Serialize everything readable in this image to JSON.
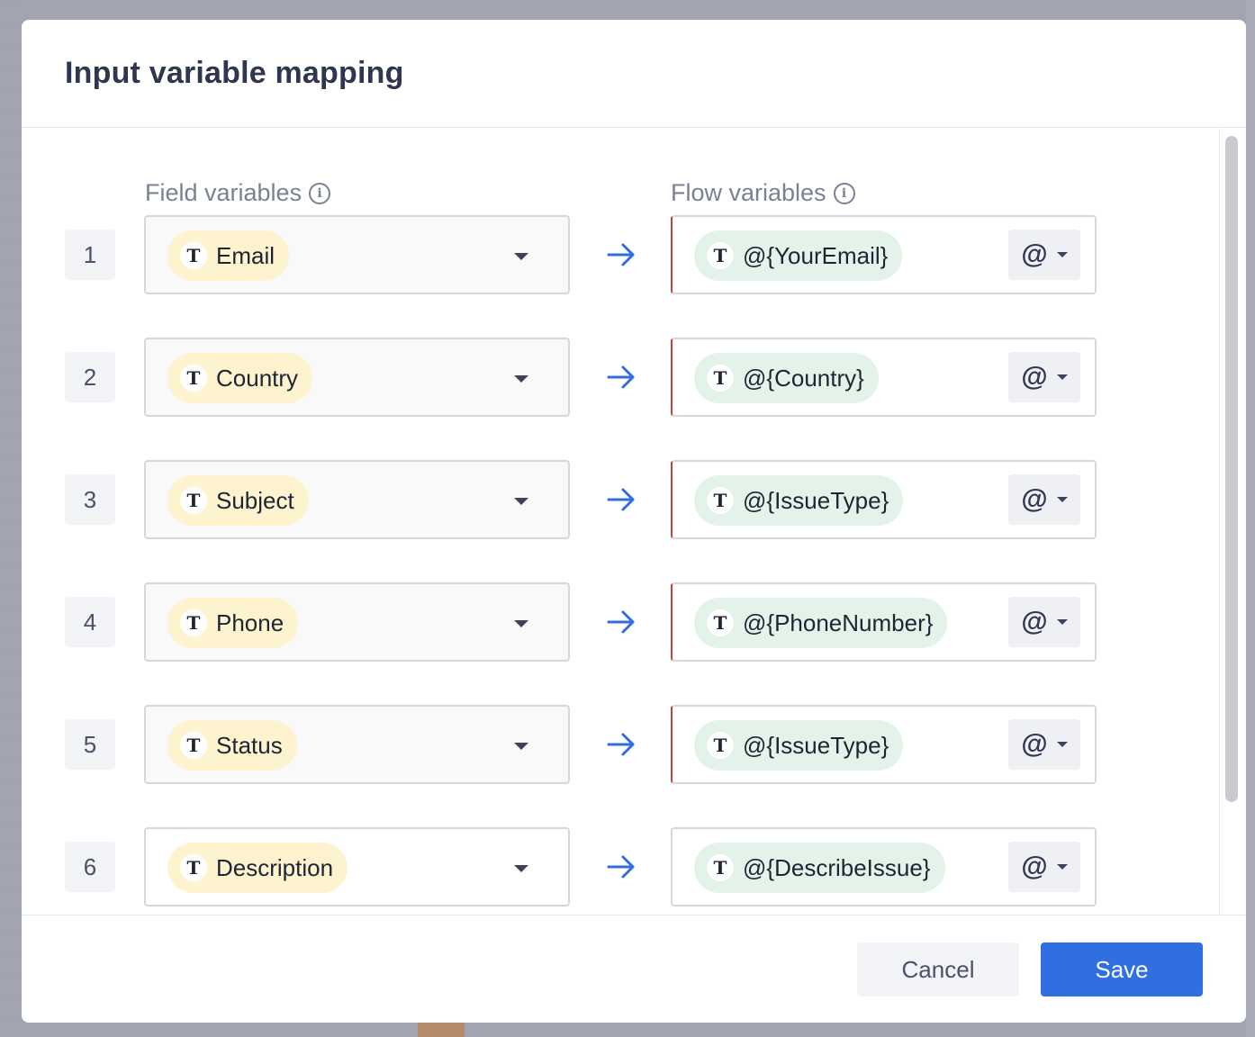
{
  "dialog": {
    "title": "Input variable mapping",
    "field_header": "Field variables",
    "flow_header": "Flow variables",
    "info_icon_glyph": "i"
  },
  "rows": [
    {
      "num": "1",
      "field": "Email",
      "flow": "@{YourEmail}",
      "error": true
    },
    {
      "num": "2",
      "field": "Country",
      "flow": "@{Country}",
      "error": true
    },
    {
      "num": "3",
      "field": "Subject",
      "flow": "@{IssueType}",
      "error": true
    },
    {
      "num": "4",
      "field": "Phone",
      "flow": "@{PhoneNumber}",
      "error": true
    },
    {
      "num": "5",
      "field": "Status",
      "flow": "@{IssueType}",
      "error": true
    },
    {
      "num": "6",
      "field": "Description",
      "flow": "@{DescribeIssue}",
      "error": false
    }
  ],
  "type_glyph": "T",
  "at_glyph": "@",
  "footer": {
    "cancel_label": "Cancel",
    "save_label": "Save"
  },
  "colors": {
    "accent": "#2f6fe0",
    "field_chip": "#fdf3cf",
    "flow_chip": "#e3f3ea",
    "error_border": "#c2413b"
  }
}
